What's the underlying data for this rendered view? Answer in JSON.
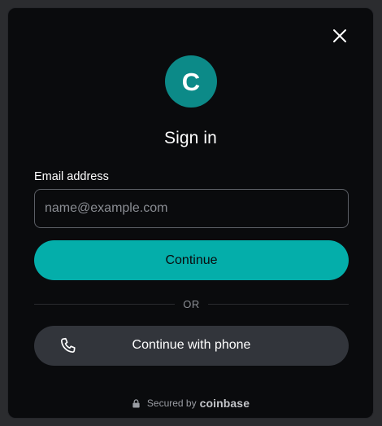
{
  "modal": {
    "close_icon": "close-icon",
    "avatar": {
      "letter": "C",
      "color": "#0c8a88"
    },
    "title": "Sign in",
    "email": {
      "label": "Email address",
      "placeholder": "name@example.com",
      "value": ""
    },
    "continue_label": "Continue",
    "divider_text": "OR",
    "phone_button": {
      "icon": "phone-icon",
      "label": "Continue with phone"
    },
    "footer": {
      "lock_icon": "lock-icon",
      "secured_text": "Secured by",
      "brand": "coinbase"
    }
  },
  "colors": {
    "accent": "#04aeaa",
    "background": "#0a0b0d",
    "secondary_button": "#32353b"
  }
}
